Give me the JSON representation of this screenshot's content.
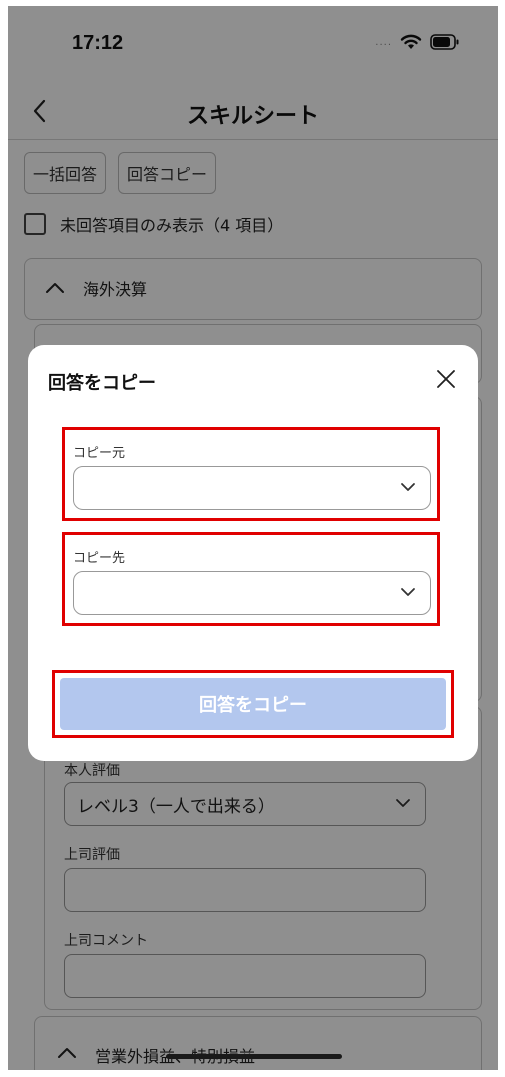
{
  "status_bar": {
    "time": "17:12",
    "signal": "....",
    "icons": [
      "wifi-icon",
      "battery-icon"
    ]
  },
  "nav": {
    "title": "スキルシート",
    "back_icon": "chevron-left-icon"
  },
  "toolbar": {
    "bulk_answer": "一括回答",
    "copy_answer": "回答コピー"
  },
  "filter": {
    "label": "未回答項目のみ表示（4 項目）",
    "checked": false
  },
  "sections": [
    {
      "title": "海外決算",
      "expanded": true
    }
  ],
  "form": {
    "self_eval_label": "本人評価",
    "self_eval_value": "レベル3（一人で出来る）",
    "boss_eval_label": "上司評価",
    "boss_eval_value": "",
    "boss_comment_label": "上司コメント",
    "boss_comment_value": ""
  },
  "bottom_section": {
    "title": "営業外損益、特別損益"
  },
  "modal": {
    "title": "回答をコピー",
    "close_icon": "close-icon",
    "source_label": "コピー元",
    "source_value": "",
    "target_label": "コピー先",
    "target_value": "",
    "submit_label": "回答をコピー",
    "submit_enabled": false
  },
  "colors": {
    "overlay": "#000000",
    "highlight": "#e00000",
    "submit_disabled": "#b3c7ee"
  }
}
